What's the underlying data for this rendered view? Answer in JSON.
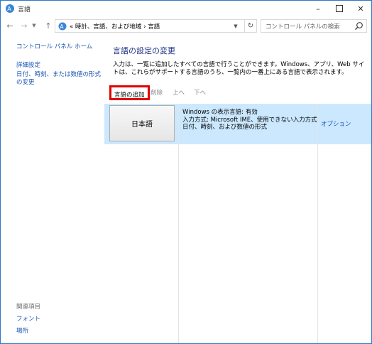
{
  "window": {
    "title": "言語",
    "minimize_icon": "minimize-icon",
    "maximize_icon": "maximize-icon",
    "close_icon": "close-icon"
  },
  "navigation": {
    "back_icon": "arrow-left-icon",
    "forward_icon": "arrow-right-icon",
    "recent_icon": "chevron-down-icon",
    "up_icon": "arrow-up-icon",
    "address": "« 時計、言語、および地域  ›  言語",
    "refresh_icon": "refresh-icon",
    "search_placeholder": "コントロール パネルの検索"
  },
  "sidebar": {
    "home": "コントロール パネル ホーム",
    "advanced": "詳細設定",
    "formats": "日付、時刻、または数値の形式の変更",
    "related_heading": "関連項目",
    "fonts": "フォント",
    "location": "場所"
  },
  "main": {
    "title": "言語の設定の変更",
    "description": "入力は、一覧に追加したすべての言語で行うことができます。Windows、アプリ、Web サイトは、これらがサポートする言語のうち、一覧内の一番上にある言語で表示されます。",
    "toolbar": {
      "add": "言語の追加",
      "remove": "削除",
      "up": "上へ",
      "down": "下へ"
    },
    "languages": [
      {
        "name": "日本語",
        "display_language": "Windows の表示言語: 有効",
        "input_method": "入力方式: Microsoft IME、使用できない入力方式",
        "formats": "日付、時刻、および数値の形式",
        "options": "オプション"
      }
    ]
  },
  "colors": {
    "window_border": "#2b78c5",
    "link": "#1a55b3",
    "heading": "#1e3287",
    "selected_row": "#cce8ff",
    "highlight_box": "#e00000"
  }
}
